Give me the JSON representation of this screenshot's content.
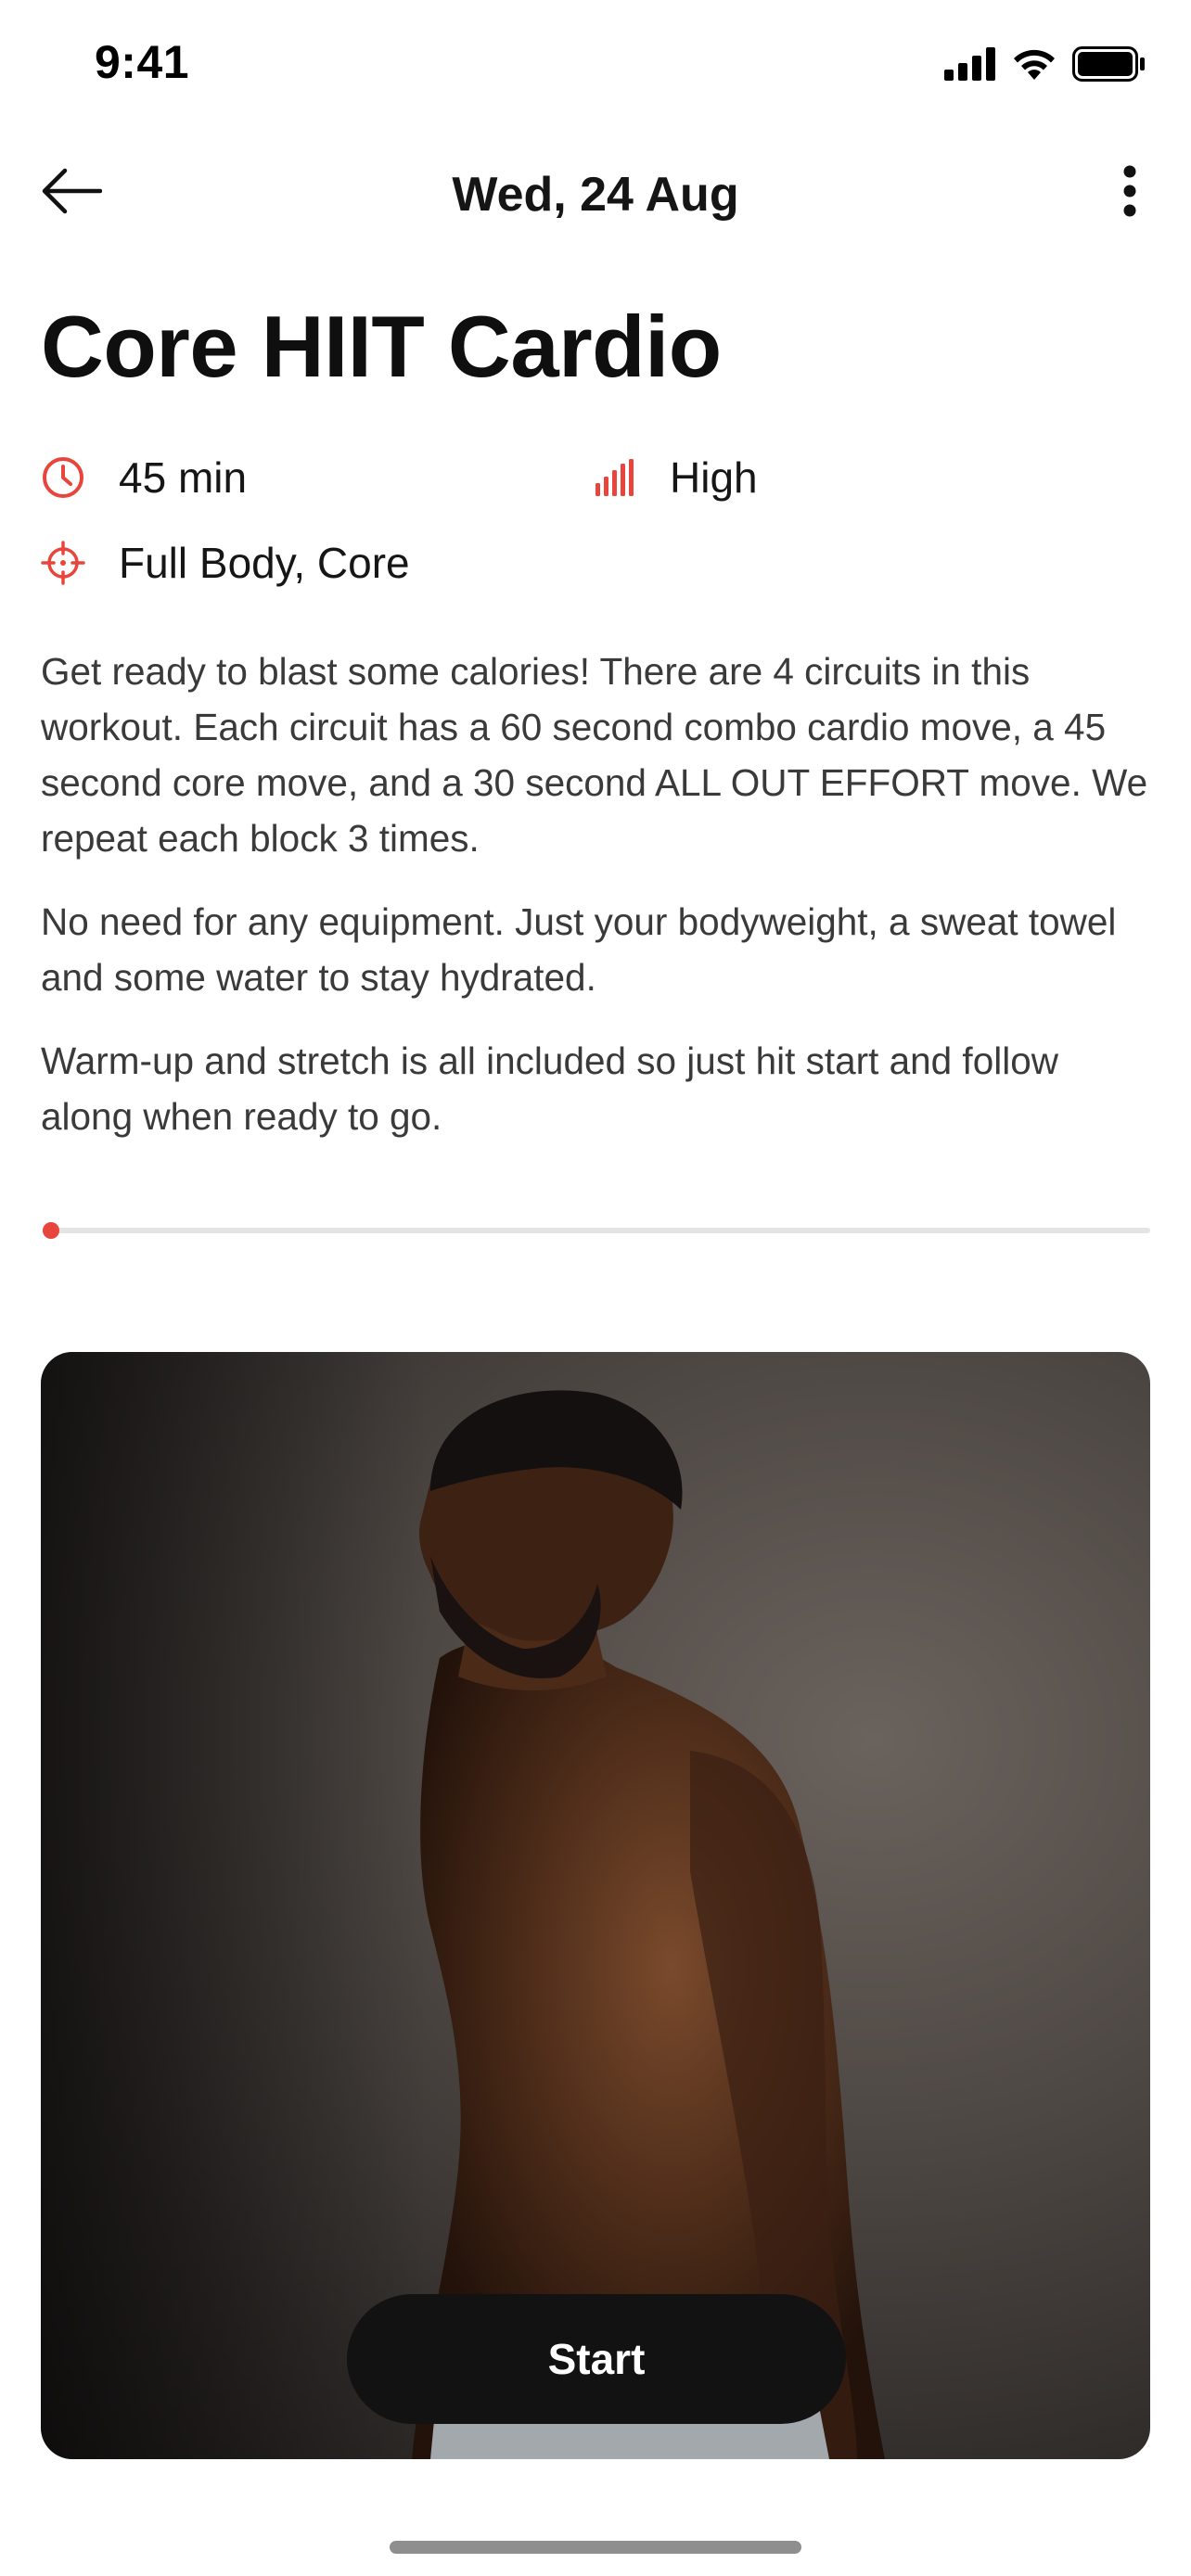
{
  "status_bar": {
    "time": "9:41",
    "icons": [
      "signal-icon",
      "wifi-icon",
      "battery-icon"
    ]
  },
  "header": {
    "date": "Wed, 24 Aug",
    "back_icon": "arrow-left-icon",
    "menu_icon": "more-vertical-icon"
  },
  "workout": {
    "title": "Core HIIT Cardio",
    "duration": "45 min",
    "intensity": "High",
    "focus": "Full Body, Core",
    "description": [
      "Get ready to blast some calories!  There are 4 circuits in this workout.  Each circuit has a 60 second combo cardio move, a 45 second core move, and a 30 second ALL OUT EFFORT move.  We repeat each block 3 times.",
      "No need for any equipment. Just your bodyweight, a sweat towel and some water to stay hydrated.",
      "Warm-up and stretch is all included so just hit start and follow along when ready to go."
    ],
    "progress_fraction": 0
  },
  "actions": {
    "start_label": "Start"
  },
  "colors": {
    "accent": "#E8453C",
    "button_bg": "#121212"
  }
}
